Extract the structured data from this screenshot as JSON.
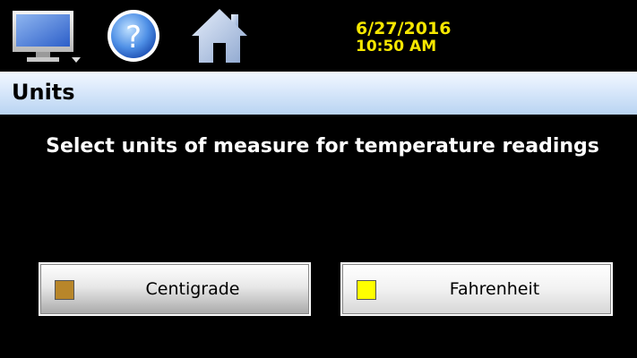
{
  "header": {
    "icons": [
      "monitor-icon",
      "help-icon",
      "home-icon"
    ],
    "date": "6/27/2016",
    "time": "10:50 AM",
    "datetime_color": "#f5e600"
  },
  "page": {
    "title": "Units",
    "prompt": "Select units of measure for temperature readings"
  },
  "options": [
    {
      "label": "Centigrade",
      "indicator_color": "#b8862a",
      "selected": false
    },
    {
      "label": "Fahrenheit",
      "indicator_color": "#ffff00",
      "selected": true
    }
  ]
}
